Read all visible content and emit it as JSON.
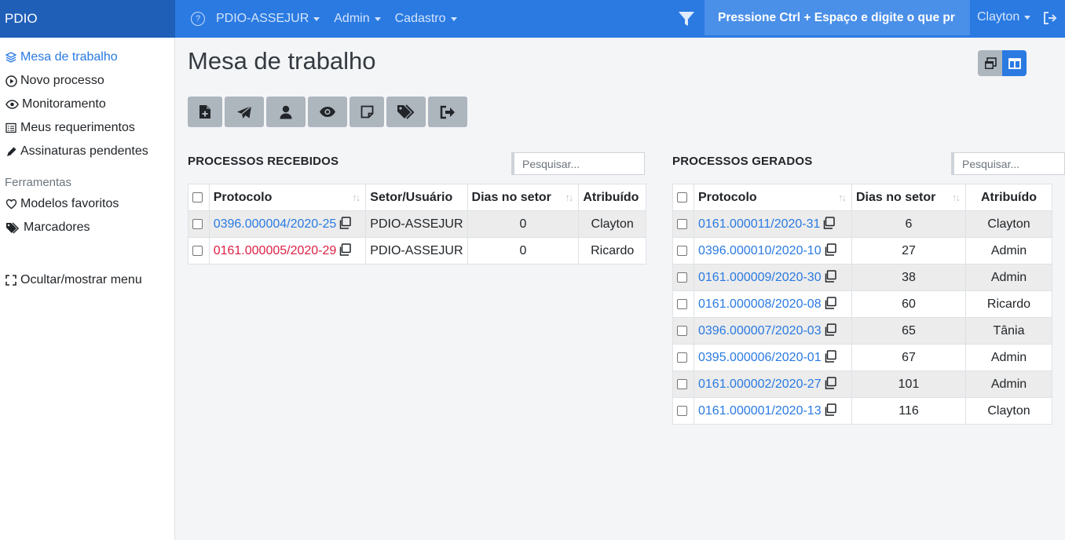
{
  "app": {
    "brand": "PDIO"
  },
  "topnav": {
    "items": [
      {
        "label": "PDIO-ASSEJUR"
      },
      {
        "label": "Admin"
      },
      {
        "label": "Cadastro"
      }
    ],
    "search_text": "Pressione Ctrl + Espaço e digite o que pr",
    "user": "Clayton"
  },
  "sidebar": {
    "items": [
      {
        "label": "Mesa de trabalho"
      },
      {
        "label": "Novo processo"
      },
      {
        "label": "Monitoramento"
      },
      {
        "label": "Meus requerimentos"
      },
      {
        "label": "Assinaturas pendentes"
      }
    ],
    "tools_heading": "Ferramentas",
    "tools": [
      {
        "label": "Modelos favoritos"
      },
      {
        "label": "Marcadores"
      }
    ],
    "toggle_label": "Ocultar/mostrar menu"
  },
  "main": {
    "title": "Mesa de trabalho",
    "received": {
      "title": "PROCESSOS RECEBIDOS",
      "search_placeholder": "Pesquisar...",
      "headers": [
        "Protocolo",
        "Setor/Usuário",
        "Dias no setor",
        "Atribuído"
      ],
      "rows": [
        {
          "protocol": "0396.000004/2020-25",
          "sector": "PDIO-ASSEJUR",
          "days": "0",
          "assignee": "Clayton"
        },
        {
          "protocol": "0161.000005/2020-29",
          "sector": "PDIO-ASSEJUR",
          "days": "0",
          "assignee": "Ricardo"
        }
      ]
    },
    "generated": {
      "title": "PROCESSOS GERADOS",
      "search_placeholder": "Pesquisar...",
      "headers": [
        "Protocolo",
        "Dias no setor",
        "Atribuído"
      ],
      "rows": [
        {
          "protocol": "0161.000011/2020-31",
          "days": "6",
          "assignee": "Clayton"
        },
        {
          "protocol": "0396.000010/2020-10",
          "days": "27",
          "assignee": "Admin"
        },
        {
          "protocol": "0161.000009/2020-30",
          "days": "38",
          "assignee": "Admin"
        },
        {
          "protocol": "0161.000008/2020-08",
          "days": "60",
          "assignee": "Ricardo"
        },
        {
          "protocol": "0396.000007/2020-03",
          "days": "65",
          "assignee": "Tânia"
        },
        {
          "protocol": "0395.000006/2020-01",
          "days": "67",
          "assignee": "Admin"
        },
        {
          "protocol": "0161.000002/2020-27",
          "days": "101",
          "assignee": "Admin"
        },
        {
          "protocol": "0161.000001/2020-13",
          "days": "116",
          "assignee": "Clayton"
        }
      ]
    }
  },
  "colors": {
    "primary": "#2a7ae2",
    "brand_bg": "#1f5fb8",
    "alert_link": "#dc1f45",
    "toolbar_btn": "#adb5bd"
  },
  "icons": {
    "toolbar": [
      "file-plus-icon",
      "paper-plane-icon",
      "user-icon",
      "eye-icon",
      "sticky-note-icon",
      "tags-icon",
      "sign-out-icon"
    ]
  }
}
